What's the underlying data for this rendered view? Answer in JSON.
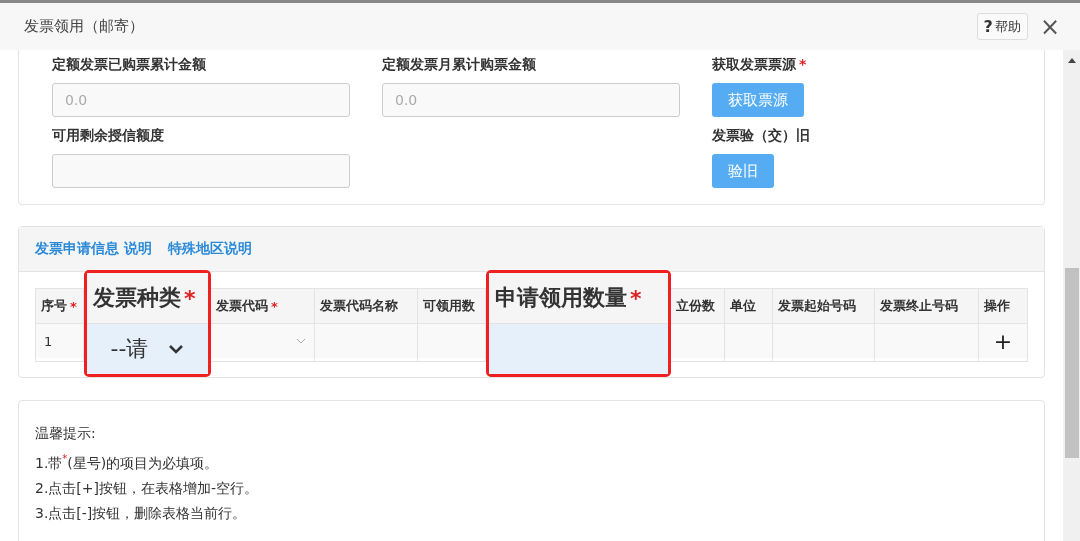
{
  "window": {
    "title": "发票领用（邮寄）",
    "help_icon": "?",
    "help": "帮助",
    "close": "×"
  },
  "required_mark": "*",
  "summary": {
    "fields": [
      {
        "label": "定额发票已购票累计金额",
        "placeholder": "0.0"
      },
      {
        "label": "定额发票月累计购票金额",
        "placeholder": "0.0"
      },
      {
        "label": "可用剩余授信额度"
      }
    ],
    "actions": [
      {
        "label": "获取发票票源",
        "required": true,
        "button": "获取票源"
      },
      {
        "label": "发票验（交）旧",
        "required": false,
        "button": "验旧"
      }
    ]
  },
  "application": {
    "links": [
      "发票申请信息 说明",
      "特殊地区说明"
    ],
    "columns": [
      {
        "label": "序号",
        "required": true,
        "kind": "plain",
        "cell": "1"
      },
      {
        "label": "发票种类",
        "required": true,
        "kind": "callout",
        "cell": "--请"
      },
      {
        "label": "发票代码",
        "required": true,
        "kind": "select"
      },
      {
        "label": "发票代码名称",
        "required": false,
        "kind": "plain"
      },
      {
        "label": "可领用数",
        "required": false,
        "kind": "plain"
      },
      {
        "label": "申请领用数量",
        "required": true,
        "kind": "callout"
      },
      {
        "label": "立份数",
        "required": false,
        "kind": "plain"
      },
      {
        "label": "单位",
        "required": false,
        "kind": "plain"
      },
      {
        "label": "发票起始号码",
        "required": false,
        "kind": "plain"
      },
      {
        "label": "发票终止号码",
        "required": false,
        "kind": "plain"
      },
      {
        "label": "操作",
        "required": false,
        "kind": "action",
        "cell": "+"
      }
    ]
  },
  "tips": {
    "title": "温馨提示:",
    "items": [
      "1.带$^{*}$(星号)的项目为必填项。",
      "2.点击[+]按钮，在表格增加-空行。",
      "3.点击[-]按钮，删除表格当前行。"
    ]
  }
}
